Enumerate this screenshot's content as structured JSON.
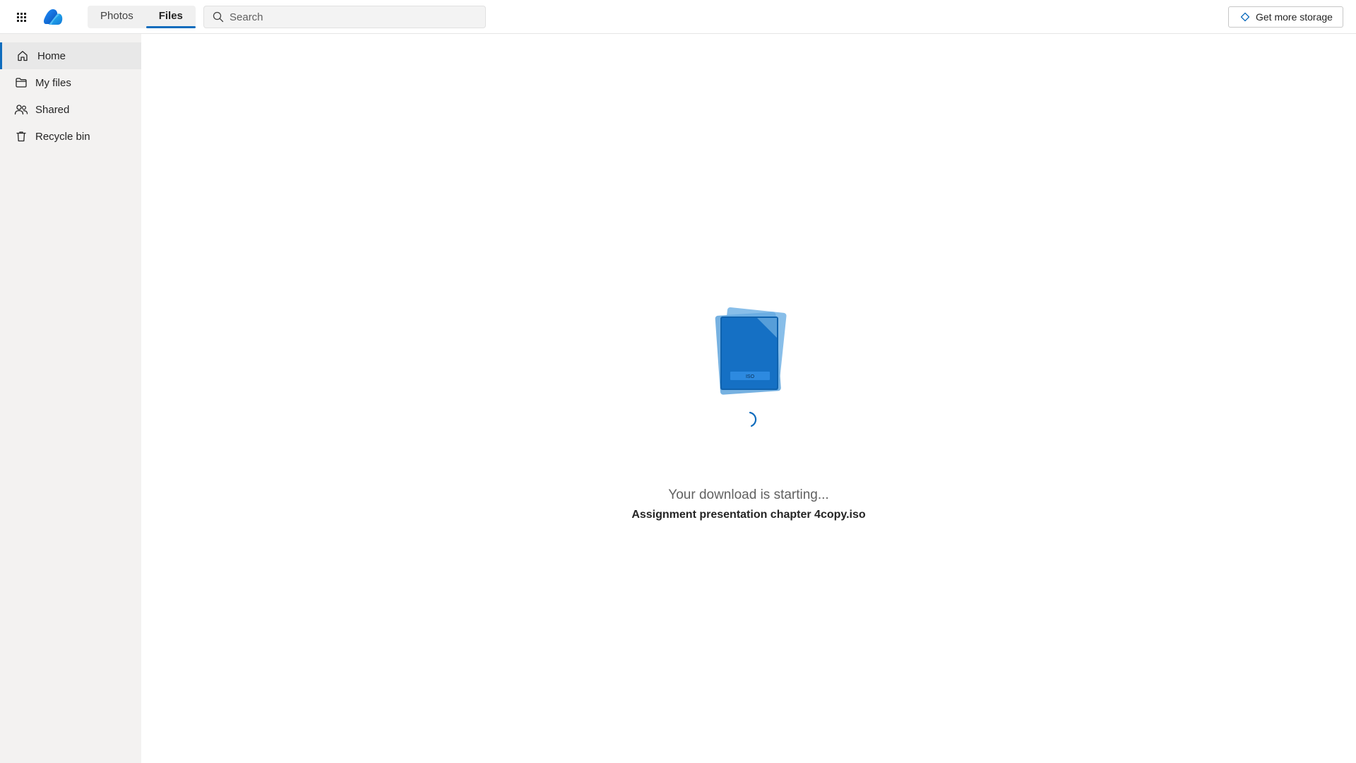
{
  "header": {
    "app_launcher_icon": "waffle-grid-icon",
    "logo_icon": "onedrive-cloud-icon",
    "tabs": [
      {
        "label": "Photos",
        "active": false
      },
      {
        "label": "Files",
        "active": true
      }
    ],
    "search": {
      "placeholder": "Search",
      "value": ""
    },
    "storage_button": {
      "label": "Get more storage",
      "icon": "diamond-icon"
    }
  },
  "sidebar": {
    "items": [
      {
        "label": "Home",
        "icon": "home-icon",
        "active": true
      },
      {
        "label": "My files",
        "icon": "folder-icon",
        "active": false
      },
      {
        "label": "Shared",
        "icon": "people-icon",
        "active": false
      },
      {
        "label": "Recycle bin",
        "icon": "trash-icon",
        "active": false
      }
    ]
  },
  "download": {
    "status": "Your download is starting...",
    "file_name": "Assignment presentation chapter 4copy.iso",
    "file_badge": "ISO"
  },
  "colors": {
    "accent": "#0f6cbd",
    "file_dark": "#0f62ae",
    "file_light": "#5ea3dc"
  }
}
